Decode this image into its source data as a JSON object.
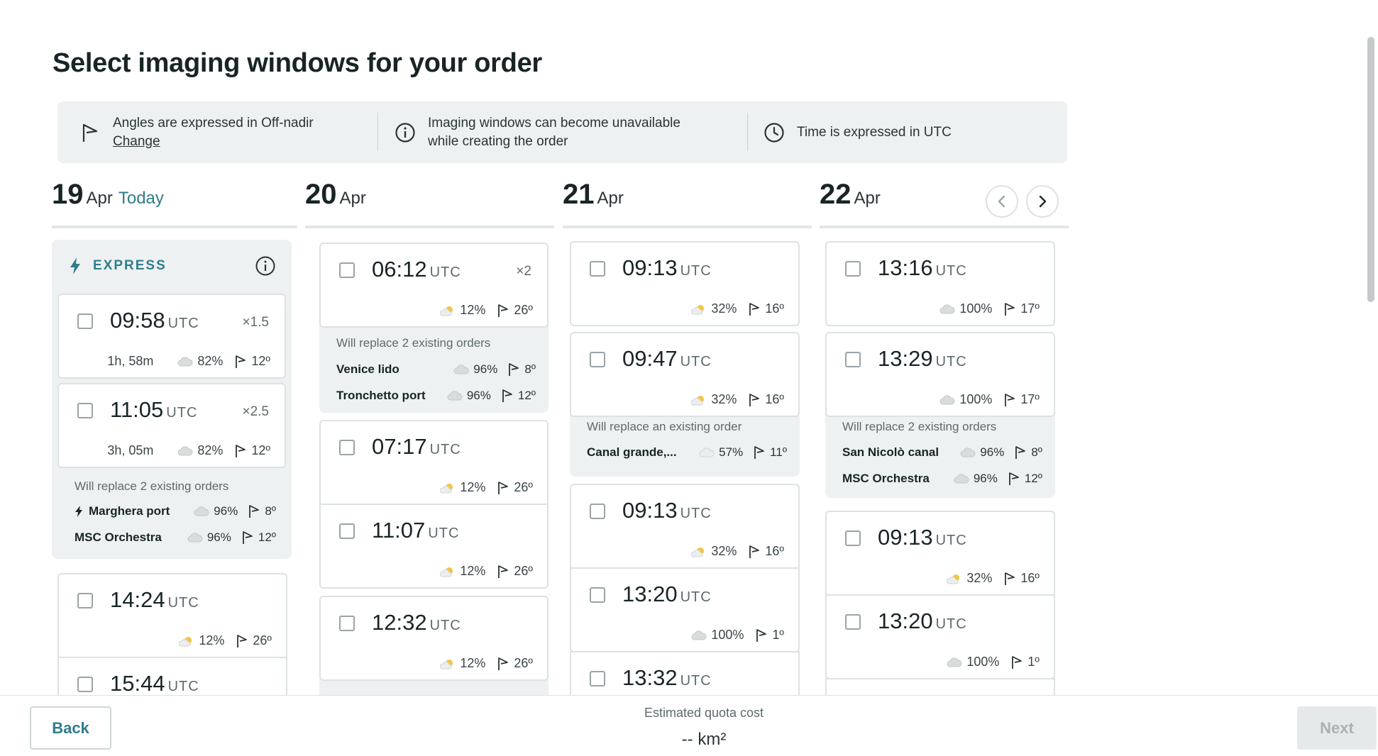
{
  "title": "Select imaging windows for your order",
  "info": {
    "angles": "Angles are expressed in Off-nadir",
    "change": "Change",
    "unavailable_line1": "Imaging windows can become unavailable",
    "unavailable_line2": "while creating the order",
    "time": "Time is expressed in UTC"
  },
  "colors": {
    "accent": "#2f7d8c",
    "panel": "#eef1f1",
    "border": "#dde2e2"
  },
  "utc_label": "UTC",
  "days": [
    {
      "num": "19",
      "month": "Apr",
      "today": "Today"
    },
    {
      "num": "20",
      "month": "Apr"
    },
    {
      "num": "21",
      "month": "Apr"
    },
    {
      "num": "22",
      "month": "Apr"
    }
  ],
  "express": {
    "label": "EXPRESS",
    "slots": [
      {
        "time": "09:58",
        "multiplier": "×1.5",
        "duration": "1h, 58m",
        "cloud": "82%",
        "angle": "12º"
      },
      {
        "time": "11:05",
        "multiplier": "×2.5",
        "duration": "3h, 05m",
        "cloud": "82%",
        "angle": "12º"
      }
    ],
    "replace": {
      "title": "Will replace 2 existing orders",
      "rows": [
        {
          "name": "Marghera port",
          "cloud": "96%",
          "angle": "8º"
        },
        {
          "name": "MSC Orchestra",
          "cloud": "96%",
          "angle": "12º"
        }
      ]
    }
  },
  "col1": {
    "slots": [
      {
        "time": "14:24",
        "cloud": "12%",
        "angle": "26º"
      },
      {
        "time": "15:44"
      }
    ]
  },
  "col2": {
    "slot_a": {
      "time": "06:12",
      "multiplier": "×2",
      "cloud": "12%",
      "angle": "26º"
    },
    "replace_a": {
      "title": "Will replace 2 existing orders",
      "rows": [
        {
          "name": "Venice lido",
          "cloud": "96%",
          "angle": "8º"
        },
        {
          "name": "Tronchetto port",
          "cloud": "96%",
          "angle": "12º"
        }
      ]
    },
    "slots": [
      {
        "time": "07:17",
        "cloud": "12%",
        "angle": "26º"
      },
      {
        "time": "11:07",
        "cloud": "12%",
        "angle": "26º"
      },
      {
        "time": "12:32",
        "cloud": "12%",
        "angle": "26º"
      }
    ]
  },
  "col3": {
    "slots_a": [
      {
        "time": "09:13",
        "cloud": "32%",
        "angle": "16º"
      },
      {
        "time": "09:47",
        "cloud": "32%",
        "angle": "16º"
      }
    ],
    "replace_a": {
      "title": "Will replace an existing order",
      "rows": [
        {
          "name": "Canal grande,...",
          "cloud": "57%",
          "angle": "11º"
        }
      ]
    },
    "slots_b": [
      {
        "time": "09:13",
        "cloud": "32%",
        "angle": "16º"
      },
      {
        "time": "13:20",
        "cloud": "100%",
        "angle": "1º"
      },
      {
        "time": "13:32"
      }
    ]
  },
  "col4": {
    "slots_a": [
      {
        "time": "13:16",
        "cloud": "100%",
        "angle": "17º"
      },
      {
        "time": "13:29",
        "cloud": "100%",
        "angle": "17º"
      }
    ],
    "replace_a": {
      "title": "Will replace 2 existing orders",
      "rows": [
        {
          "name": "San Nicolò canal",
          "cloud": "96%",
          "angle": "8º"
        },
        {
          "name": "MSC Orchestra",
          "cloud": "96%",
          "angle": "12º"
        }
      ]
    },
    "slots_b": [
      {
        "time": "09:13",
        "cloud": "32%",
        "angle": "16º"
      },
      {
        "time": "13:20",
        "cloud": "100%",
        "angle": "1º"
      }
    ]
  },
  "footer": {
    "back": "Back",
    "quota_label": "Estimated quota cost",
    "quota_value": "-- km²",
    "next": "Next"
  }
}
